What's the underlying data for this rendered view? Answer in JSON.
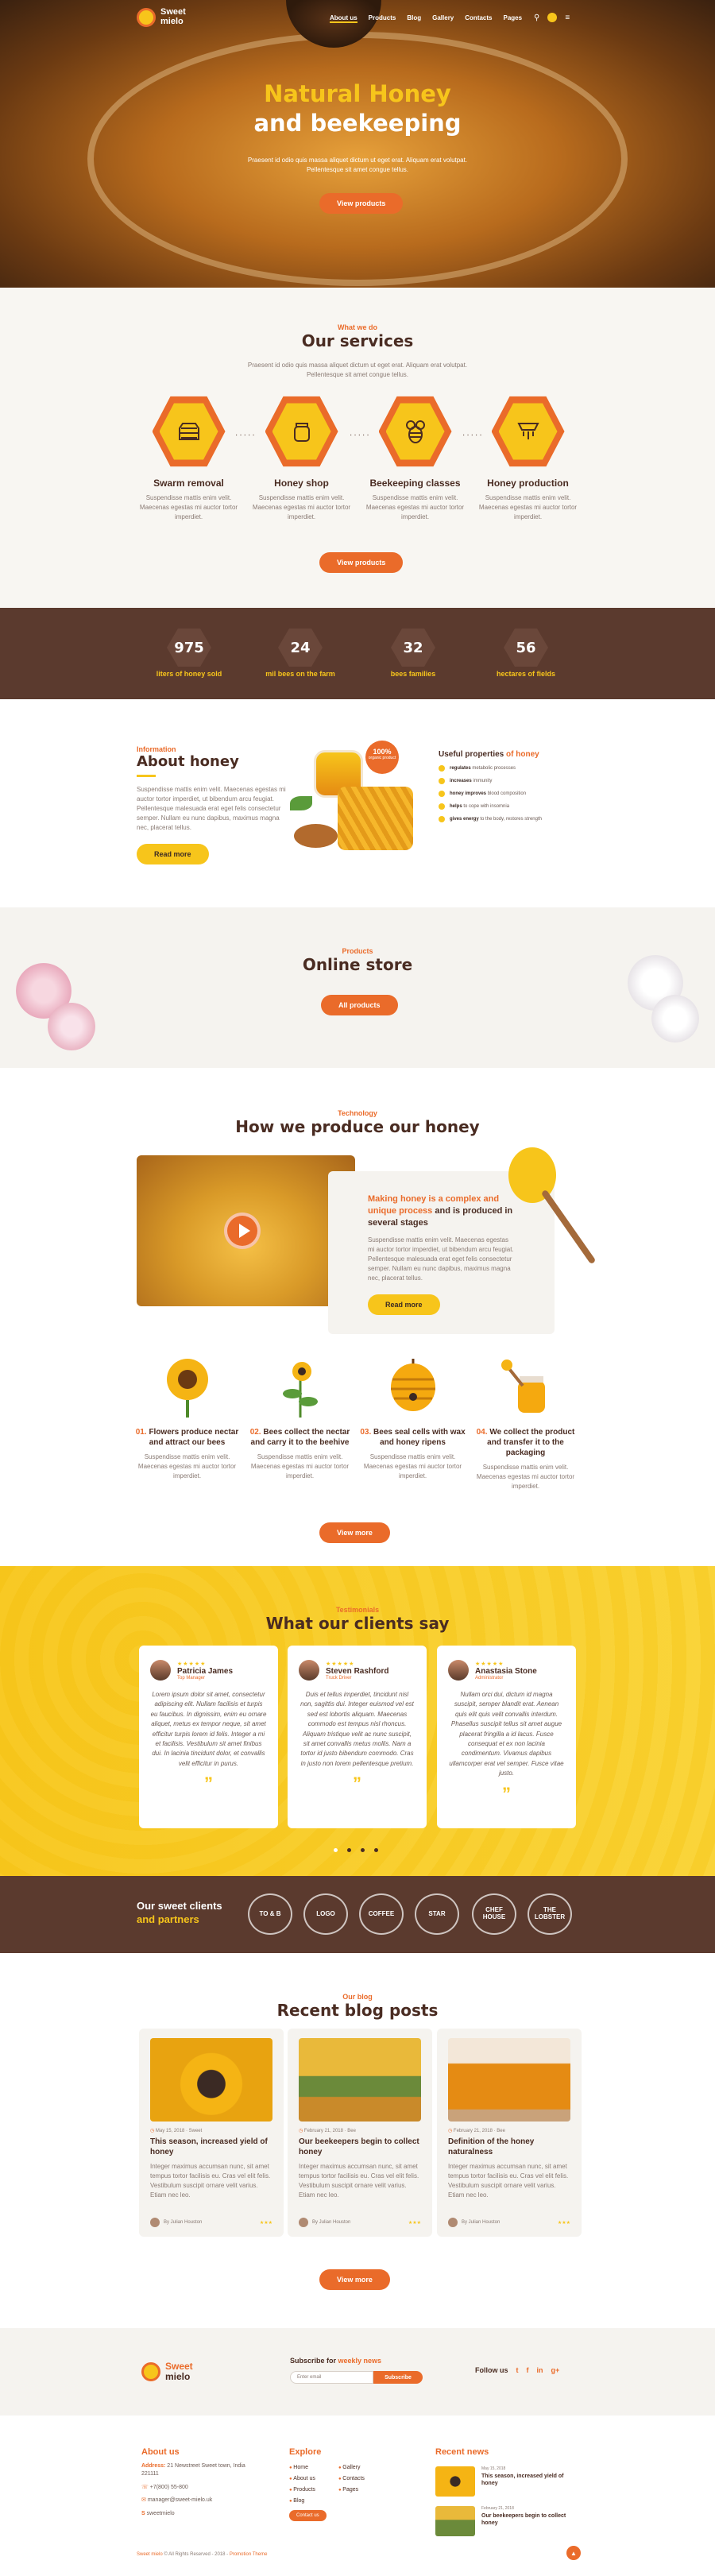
{
  "nav": {
    "logo_line1": "Sweet",
    "logo_line2": "mielo",
    "items": [
      "About us",
      "Products",
      "Blog",
      "Gallery",
      "Contacts",
      "Pages"
    ]
  },
  "hero": {
    "title_line1": "Natural Honey",
    "title_line2": "and beekeeping",
    "subtitle": "Praesent id odio quis massa aliquet dictum ut eget erat. Aliquam erat volutpat. Pellentesque sit amet congue tellus.",
    "button": "View products"
  },
  "services": {
    "kicker": "What we do",
    "title": "Our services",
    "description": "Praesent id odio quis massa aliquet dictum ut eget erat. Aliquam erat volutpat. Pellentesque sit amet congue tellus.",
    "items": [
      {
        "title": "Swarm removal",
        "text": "Suspendisse mattis enim velit. Maecenas egestas mi auctor tortor imperdiet.",
        "icon": "beehive-icon"
      },
      {
        "title": "Honey shop",
        "text": "Suspendisse mattis enim velit. Maecenas egestas mi auctor tortor imperdiet.",
        "icon": "honey-jar-icon"
      },
      {
        "title": "Beekeeping classes",
        "text": "Suspendisse mattis enim velit. Maecenas egestas mi auctor tortor imperdiet.",
        "icon": "bee-icon"
      },
      {
        "title": "Honey production",
        "text": "Suspendisse mattis enim velit. Maecenas egestas mi auctor tortor imperdiet.",
        "icon": "honeycomb-icon"
      }
    ],
    "button": "View products"
  },
  "stats": [
    {
      "value": "975",
      "label": "liters of honey sold"
    },
    {
      "value": "24",
      "label": "mil bees on the farm"
    },
    {
      "value": "32",
      "label": "bees families"
    },
    {
      "value": "56",
      "label": "hectares of fields"
    }
  ],
  "about": {
    "kicker": "Information",
    "title": "About honey",
    "text": "Suspendisse mattis enim velit. Maecenas egestas mi auctor tortor imperdiet, ut bibendum arcu feugiat. Pellentesque malesuada erat eget felis consectetur semper. Nullam eu nunc dapibus, maximus magna nec, placerat tellus.",
    "button": "Read more",
    "badge_value": "100%",
    "badge_text": "organic product",
    "props_title_a": "Useful properties",
    "props_title_b": "of honey",
    "props": [
      {
        "bold": "regulates",
        "rest": "metabolic processes"
      },
      {
        "bold": "increases",
        "rest": "immunity"
      },
      {
        "bold": "honey improves",
        "rest": "blood composition"
      },
      {
        "bold": "helps",
        "rest": "to cope with insomnia"
      },
      {
        "bold": "gives energy",
        "rest": "to the body, restores strength"
      }
    ]
  },
  "store": {
    "kicker": "Products",
    "title": "Online store",
    "button": "All products"
  },
  "produce": {
    "kicker": "Technology",
    "title": "How we produce our honey",
    "card_title_a": "Making honey is a complex and unique process",
    "card_title_b": "and is produced in several stages",
    "card_text": "Suspendisse mattis enim velit. Maecenas egestas mi auctor tortor imperdiet, ut bibendum arcu feugiat. Pellentesque malesuada erat eget felis consectetur semper. Nullam eu nunc dapibus, maximus magna nec, placerat tellus.",
    "card_button": "Read more",
    "steps": [
      {
        "num": "01.",
        "title": "Flowers produce nectar and attract our bees",
        "text": "Suspendisse mattis enim velit. Maecenas egestas mi auctor tortor imperdiet."
      },
      {
        "num": "02.",
        "title": "Bees collect the nectar and carry it to the beehive",
        "text": "Suspendisse mattis enim velit. Maecenas egestas mi auctor tortor imperdiet."
      },
      {
        "num": "03.",
        "title": "Bees seal cells with wax and honey ripens",
        "text": "Suspendisse mattis enim velit. Maecenas egestas mi auctor tortor imperdiet."
      },
      {
        "num": "04.",
        "title": "We collect the product and transfer it to the packaging",
        "text": "Suspendisse mattis enim velit. Maecenas egestas mi auctor tortor imperdiet."
      }
    ],
    "button": "View more"
  },
  "testimonials": {
    "kicker": "Testimonials",
    "title": "What our clients say",
    "items": [
      {
        "name": "Patricia James",
        "role": "Top Manager",
        "quote": "Lorem ipsum dolor sit amet, consectetur adipiscing elit. Nullam facilisis et turpis eu faucibus. In dignissim, enim eu ornare aliquet, metus ex tempor neque, sit amet efficitur turpis lorem id felis. Integer a mi et facilisis. Vestibulum sit amet finibus dui. In lacinia tincidunt dolor, et convallis velit efficitur in purus."
      },
      {
        "name": "Steven Rashford",
        "role": "Truck Driver",
        "quote": "Duis et tellus imperdiet, tincidunt nisl non, sagittis dui. Integer euismod vel est sed est lobortis aliquam. Maecenas commodo est tempus nisl rhoncus. Aliquam tristique velit ac nunc suscipit, sit amet convallis metus mollis. Nam a tortor id justo bibendum commodo. Cras in justo non lorem pellentesque pretium."
      },
      {
        "name": "Anastasia Stone",
        "role": "Administrator",
        "quote": "Nullam orci dui, dictum id magna suscipit, semper blandit erat. Aenean quis elit quis velit convallis interdum. Phasellus suscipit tellus sit amet augue placerat fringilla a id lacus. Fusce consequat et ex non lacinia condimentum. Vivamus dapibus ullamcorper erat vel semper. Fusce vitae justo."
      }
    ]
  },
  "partners": {
    "title_a": "Our sweet clients",
    "title_b": "and partners",
    "logos": [
      "TO & B",
      "LOGO",
      "COFFEE",
      "STAR",
      "CHEF HOUSE",
      "THE LOBSTER"
    ]
  },
  "blog": {
    "kicker": "Our blog",
    "title": "Recent blog posts",
    "posts": [
      {
        "date": "May 15, 2018",
        "cat": "Sweet",
        "title": "This season, increased yield of honey",
        "excerpt": "Integer maximus accumsan nunc, sit amet tempus tortor facilisis eu. Cras vel elit felis. Vestibulum suscipit ornare velit varius. Etiam nec leo.",
        "author": "By Julian Houston"
      },
      {
        "date": "February 21, 2018",
        "cat": "Bee",
        "title": "Our beekeepers begin to collect honey",
        "excerpt": "Integer maximus accumsan nunc, sit amet tempus tortor facilisis eu. Cras vel elit felis. Vestibulum suscipit ornare velit varius. Etiam nec leo.",
        "author": "By Julian Houston"
      },
      {
        "date": "February 21, 2018",
        "cat": "Bee",
        "title": "Definition of the honey naturalness",
        "excerpt": "Integer maximus accumsan nunc, sit amet tempus tortor facilisis eu. Cras vel elit felis. Vestibulum suscipit ornare velit varius. Etiam nec leo.",
        "author": "By Julian Houston"
      }
    ],
    "button": "View more"
  },
  "newsletter": {
    "logo_a": "Sweet",
    "logo_b": "mielo",
    "title_a": "Subscribe for",
    "title_b": "weekly news",
    "placeholder": "Enter email",
    "button": "Subscribe",
    "follow": "Follow us",
    "social": [
      "t",
      "f",
      "in",
      "g+"
    ]
  },
  "footer": {
    "about_title": "About us",
    "address_label": "Address:",
    "address": "21 Newstreet Sweet town, India 221111",
    "phone": "+7(800) 55-800",
    "email": "manager@sweet-mielo.uk",
    "skype": "sweetmielo",
    "explore_title": "Explore",
    "links": [
      "Home",
      "Gallery",
      "About us",
      "Contacts",
      "Products",
      "Pages",
      "Blog"
    ],
    "contact_btn": "Contact us",
    "news_title": "Recent news",
    "news": [
      {
        "date": "May 15, 2018",
        "title": "This season, increased yield of honey"
      },
      {
        "date": "February 21, 2018",
        "title": "Our beekeepers begin to collect honey"
      }
    ],
    "copyright_a": "Sweet mielo",
    "copyright_b": "© All Rights Reserved - 2018 -",
    "copyright_c": "Promotion Theme",
    "totop": "▲"
  }
}
